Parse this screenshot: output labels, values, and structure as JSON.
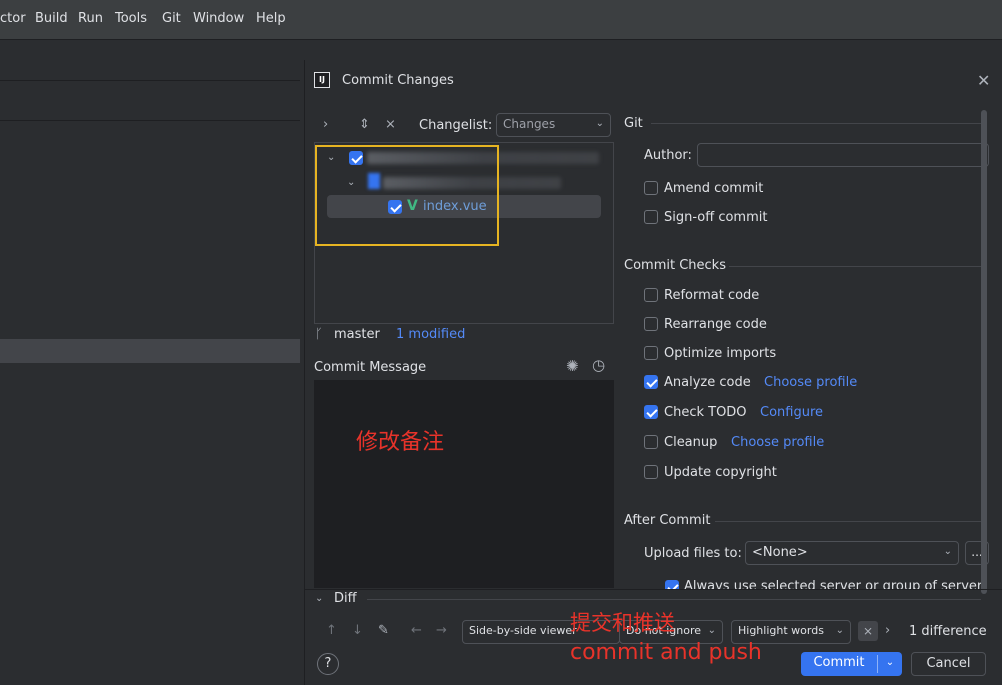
{
  "menubar": {
    "items": [
      "ctor",
      "Build",
      "Run",
      "Tools",
      "Git",
      "Window",
      "Help"
    ]
  },
  "dialog": {
    "title": "Commit Changes",
    "app_icon": "IJ",
    "changelist_label": "Changelist:",
    "changelist_value": "Changes",
    "tree": {
      "file_name": "index.vue",
      "file_icon": "V"
    },
    "branch": "master",
    "modified": "1 modified",
    "commit_message_label": "Commit Message",
    "commit_message_value": "修改备注",
    "git": {
      "title": "Git",
      "author_label": "Author:",
      "author_value": "",
      "amend": "Amend commit",
      "signoff": "Sign-off commit"
    },
    "checks": {
      "title": "Commit Checks",
      "reformat": "Reformat code",
      "rearrange": "Rearrange code",
      "optimize": "Optimize imports",
      "analyze": "Analyze code",
      "analyze_link": "Choose profile",
      "todo": "Check TODO",
      "todo_link": "Configure",
      "cleanup": "Cleanup",
      "cleanup_link": "Choose profile",
      "copyright": "Update copyright"
    },
    "after": {
      "title": "After Commit",
      "upload_label": "Upload files to:",
      "upload_value": "<None>",
      "more": "...",
      "always_use": "Always use selected server or group of servers"
    },
    "diff": {
      "title": "Diff",
      "viewer": "Side-by-side viewer",
      "ignore": "Do not ignore",
      "highlight": "Highlight words",
      "count": "1 difference"
    },
    "buttons": {
      "commit": "Commit",
      "cancel": "Cancel",
      "help": "?"
    },
    "annotation": {
      "zh": "提交和推送",
      "en": "commit and push"
    }
  },
  "colors": {
    "accent": "#3574f0",
    "link": "#548af7",
    "annotation": "#e8332a",
    "highlight_box": "#e6b422"
  }
}
